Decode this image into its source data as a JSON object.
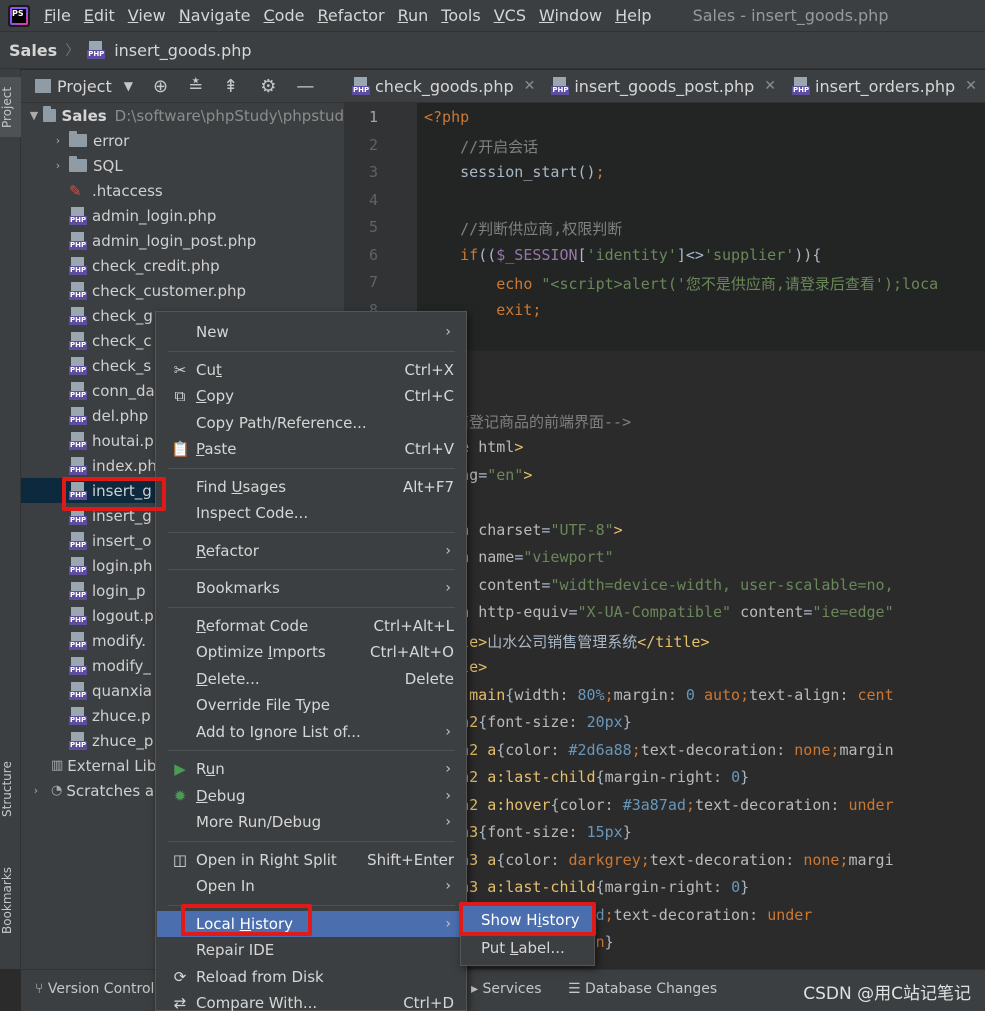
{
  "menubar": {
    "items": [
      "File",
      "Edit",
      "View",
      "Navigate",
      "Code",
      "Refactor",
      "Run",
      "Tools",
      "VCS",
      "Window",
      "Help"
    ],
    "mnemonics": [
      0,
      0,
      0,
      0,
      0,
      0,
      0,
      0,
      0,
      0,
      0
    ],
    "window_title": "Sales - insert_goods.php"
  },
  "breadcrumb": {
    "project": "Sales",
    "file": "insert_goods.php"
  },
  "sidebar": {
    "project_tab": "Project",
    "structure_tab": "Structure",
    "bookmarks_tab": "Bookmarks"
  },
  "project_panel": {
    "title": "Project",
    "root_name": "Sales",
    "root_path": "D:\\software\\phpStudy\\phpstud",
    "items": [
      {
        "type": "folder",
        "name": "error",
        "expanded": false
      },
      {
        "type": "folder",
        "name": "SQL",
        "expanded": false
      },
      {
        "type": "htaccess",
        "name": ".htaccess"
      },
      {
        "type": "php",
        "name": "admin_login.php"
      },
      {
        "type": "php",
        "name": "admin_login_post.php"
      },
      {
        "type": "php",
        "name": "check_credit.php"
      },
      {
        "type": "php",
        "name": "check_customer.php"
      },
      {
        "type": "php",
        "name": "check_g"
      },
      {
        "type": "php",
        "name": "check_c"
      },
      {
        "type": "php",
        "name": "check_s"
      },
      {
        "type": "php",
        "name": "conn_da"
      },
      {
        "type": "php",
        "name": "del.php"
      },
      {
        "type": "php",
        "name": "houtai.p"
      },
      {
        "type": "php",
        "name": "index.ph"
      },
      {
        "type": "php",
        "name": "insert_g",
        "selected": true
      },
      {
        "type": "php",
        "name": "insert_g"
      },
      {
        "type": "php",
        "name": "insert_o"
      },
      {
        "type": "php",
        "name": "login.ph"
      },
      {
        "type": "php",
        "name": "login_p"
      },
      {
        "type": "php",
        "name": "logout.p"
      },
      {
        "type": "php",
        "name": "modify."
      },
      {
        "type": "php",
        "name": "modify_"
      },
      {
        "type": "php",
        "name": "quanxia"
      },
      {
        "type": "php",
        "name": "zhuce.p"
      },
      {
        "type": "php",
        "name": "zhuce_p"
      }
    ],
    "external_libraries": "External Lib",
    "scratches": "Scratches a"
  },
  "editor_tabs": [
    {
      "name": "check_goods.php"
    },
    {
      "name": "insert_goods_post.php"
    },
    {
      "name": "insert_orders.php"
    }
  ],
  "code_lines": [
    {
      "n": "1",
      "html": "<span class='c-kw'>&lt;?php</span>"
    },
    {
      "n": "2",
      "html": "    <span class='c-cm'>//开启会话</span>"
    },
    {
      "n": "3",
      "html": "    session_start()<span class='c-kw'>;</span>"
    },
    {
      "n": "4",
      "html": ""
    },
    {
      "n": "5",
      "html": "    <span class='c-cm'>//判断供应商,权限判断</span>"
    },
    {
      "n": "6",
      "html": "    <span class='c-kw'>if</span>((<span class='c-var'>$_SESSION</span>[<span class='c-str'>'identity'</span>]&lt;&gt;<span class='c-str'>'supplier'</span>)){"
    },
    {
      "n": "7",
      "html": "        <span class='c-kw'>echo</span> <span class='c-str'>\"&lt;script&gt;alert('您不是供应商,请登录后查看');loca</span>"
    },
    {
      "n": "8",
      "html": "        <span class='c-kw'>exit;</span>"
    },
    {
      "n": "",
      "html": "}"
    },
    {
      "n": "",
      "html": ""
    },
    {
      "n": "",
      "html": ""
    },
    {
      "n": "",
      "html": "<span class='c-cm'>供应商登记商品的前端界面--&gt;</span>"
    },
    {
      "n": "",
      "html": "<span class='c-tag'>ctype</span> <span class='c-attr'>html</span><span class='c-tag'>&gt;</span>"
    },
    {
      "n": "",
      "html": "<span class='c-tag'>l</span> <span class='c-attr'>lang</span>=<span class='c-str'>\"en\"</span><span class='c-tag'>&gt;</span>"
    },
    {
      "n": "",
      "html": "<span class='c-tag'>d&gt;</span>"
    },
    {
      "n": "",
      "html": "<span class='c-tag'>&lt;meta</span> <span class='c-attr'>charset</span>=<span class='c-str'>\"UTF-8\"</span><span class='c-tag'>&gt;</span>"
    },
    {
      "n": "",
      "html": "<span class='c-tag'>&lt;meta</span> <span class='c-attr'>name</span>=<span class='c-str'>\"viewport\"</span>"
    },
    {
      "n": "",
      "html": "      <span class='c-attr'>content</span>=<span class='c-str'>\"width=device-width, user-scalable=no,</span>"
    },
    {
      "n": "",
      "html": "<span class='c-tag'>&lt;meta</span> <span class='c-attr'>http-equiv</span>=<span class='c-str'>\"X-UA-Compatible\"</span> <span class='c-attr'>content</span>=<span class='c-str'>\"ie=edge\"</span>"
    },
    {
      "n": "",
      "html": "<span class='c-tag'>&lt;title&gt;</span>山水公司销售管理系统<span class='c-tag'>&lt;/title&gt;</span>"
    },
    {
      "n": "",
      "html": "<span class='c-tag'>&lt;style&gt;</span>"
    },
    {
      "n": "",
      "html": "    <span class='c-sel'>.main</span>{<span class='c-prop'>width</span>: <span class='c-num'>80%</span><span class='c-kw'>;</span><span class='c-prop'>margin</span>: <span class='c-num'>0</span> <span class='c-kw'>auto;</span><span class='c-prop'>text-align</span>: <span class='c-kw'>cent</span>"
    },
    {
      "n": "",
      "html": "    <span class='c-sel'>h2</span>{<span class='c-prop'>font-size</span>: <span class='c-num'>20px</span>}"
    },
    {
      "n": "",
      "html": "    <span class='c-sel'>h2 a</span>{<span class='c-prop'>color</span>: <span class='c-num'>#2d6a88</span><span class='c-kw'>;</span><span class='c-prop'>text-decoration</span>: <span class='c-kw'>none;</span><span class='c-prop'>margin</span>"
    },
    {
      "n": "",
      "html": "    <span class='c-sel'>h2 a:last-child</span>{<span class='c-prop'>margin-right</span>: <span class='c-num'>0</span>}"
    },
    {
      "n": "",
      "html": "    <span class='c-sel'>h2 a:hover</span>{<span class='c-prop'>color</span>: <span class='c-num'>#3a87ad</span><span class='c-kw'>;</span><span class='c-prop'>text-decoration</span>: <span class='c-kw'>under</span>"
    },
    {
      "n": "",
      "html": "    <span class='c-sel'>h3</span>{<span class='c-prop'>font-size</span>: <span class='c-num'>15px</span>}"
    },
    {
      "n": "",
      "html": "    <span class='c-sel'>h3 a</span>{<span class='c-prop'>color</span>: <span class='c-kw'>darkgrey;</span><span class='c-prop'>text-decoration</span>: <span class='c-kw'>none;</span><span class='c-prop'>margi</span>"
    },
    {
      "n": "",
      "html": "    <span class='c-sel'>h3 a:last-child</span>{<span class='c-prop'>margin-right</span>: <span class='c-num'>0</span>}"
    },
    {
      "n": "",
      "html": "    <span class='c-sel'>r</span>{<span class='c-prop'>color</span>: <span class='c-num'>#3a87ad</span><span class='c-kw'>;</span><span class='c-prop'>text-decoration</span>: <span class='c-kw'>under</span>"
    },
    {
      "n": "",
      "html": "     <span class='c-prop'>color</span>: <span class='c-kw'>darkcyan</span>}"
    }
  ],
  "context_menu": {
    "items": [
      {
        "label": "New",
        "submenu": true
      },
      {
        "label": "Cut",
        "shortcut": "Ctrl+X",
        "icon": "✂",
        "icon_name": "cut-icon",
        "u": 2
      },
      {
        "label": "Copy",
        "shortcut": "Ctrl+C",
        "icon": "⧉",
        "icon_name": "copy-icon",
        "u": 0
      },
      {
        "label": "Copy Path/Reference..."
      },
      {
        "label": "Paste",
        "shortcut": "Ctrl+V",
        "icon": "📋",
        "icon_name": "paste-icon",
        "u": 0
      },
      {
        "label": "Find Usages",
        "shortcut": "Alt+F7",
        "u": 5
      },
      {
        "label": "Inspect Code..."
      },
      {
        "label": "Refactor",
        "submenu": true,
        "u": 0
      },
      {
        "label": "Bookmarks",
        "submenu": true
      },
      {
        "label": "Reformat Code",
        "shortcut": "Ctrl+Alt+L",
        "u": 0
      },
      {
        "label": "Optimize Imports",
        "shortcut": "Ctrl+Alt+O",
        "u": 9
      },
      {
        "label": "Delete...",
        "shortcut": "Delete",
        "u": 0
      },
      {
        "label": "Override File Type"
      },
      {
        "label": "Add to Ignore List of...",
        "submenu": true
      },
      {
        "label": "Run",
        "submenu": true,
        "icon": "▶",
        "icon_name": "run-icon",
        "icon_color": "#499c54",
        "u": 1
      },
      {
        "label": "Debug",
        "submenu": true,
        "icon": "✹",
        "icon_name": "debug-icon",
        "icon_color": "#499c54",
        "u": 0
      },
      {
        "label": "More Run/Debug",
        "submenu": true
      },
      {
        "label": "Open in Right Split",
        "shortcut": "Shift+Enter",
        "icon": "◫",
        "icon_name": "split-icon"
      },
      {
        "label": "Open In",
        "submenu": true
      },
      {
        "label": "Local History",
        "submenu": true,
        "highlighted": true,
        "u": 6
      },
      {
        "label": "Repair IDE"
      },
      {
        "label": "Reload from Disk",
        "icon": "⟳",
        "icon_name": "reload-icon"
      },
      {
        "label": "Compare With...",
        "shortcut": "Ctrl+D",
        "icon": "⇄",
        "icon_name": "compare-icon"
      }
    ]
  },
  "submenu": {
    "items": [
      {
        "label": "Show History",
        "highlighted": true
      },
      {
        "label": "Put Label..."
      }
    ]
  },
  "bottom_bar": {
    "version_control": "Version Control",
    "services": "Services",
    "database_changes": "Database Changes"
  },
  "watermark": "CSDN @用C站记笔记",
  "colors": {
    "highlight": "#4b6eaf",
    "annotation_red": "#e01919",
    "selection": "#0d293e"
  }
}
